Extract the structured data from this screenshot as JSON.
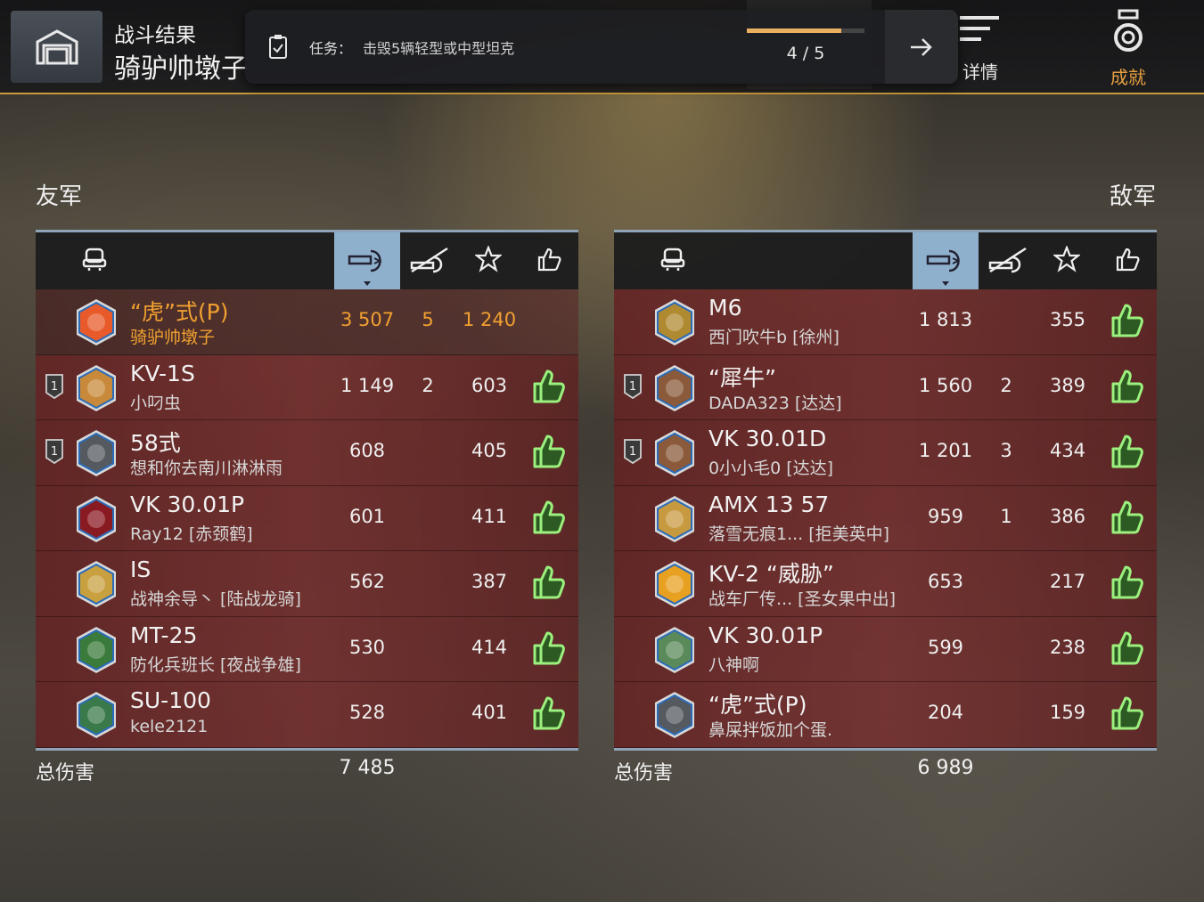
{
  "header": {
    "battle_label": "战斗结果",
    "player_name": "骑驴帅墩子",
    "nav": [
      {
        "label": "详情",
        "icon": "details-icon"
      },
      {
        "label": "成就",
        "icon": "medal-icon"
      }
    ]
  },
  "quest": {
    "label": "任务：",
    "text": "击毁5辆轻型或中型坦克",
    "progress_text": "4 / 5",
    "progress_fraction": 0.8
  },
  "ally": {
    "title": "友军",
    "total_label": "总伤害",
    "total_value": "7 485",
    "rows": [
      {
        "tank": "“虎”式(P)",
        "player": "骑驴帅墩子",
        "damage": "3 507",
        "kills": "5",
        "xp": "1 240",
        "self": true,
        "platoon": false,
        "rank_color": "#e85a2a",
        "liked": false
      },
      {
        "tank": "KV-1S",
        "player": "小叼虫",
        "damage": "1 149",
        "kills": "2",
        "xp": "603",
        "platoon": true,
        "rank_color": "#c88a3a",
        "liked": true
      },
      {
        "tank": "58式",
        "player": "想和你去南川淋淋雨",
        "damage": "608",
        "kills": "",
        "xp": "405",
        "platoon": true,
        "rank_color": "#555a60",
        "liked": true
      },
      {
        "tank": "VK 30.01P",
        "player": "Ray12 [赤颈鹤]",
        "damage": "601",
        "kills": "",
        "xp": "411",
        "platoon": false,
        "rank_color": "#8a1a22",
        "liked": true
      },
      {
        "tank": "IS",
        "player": "战神余导丶 [陆战龙骑]",
        "damage": "562",
        "kills": "",
        "xp": "387",
        "platoon": false,
        "rank_color": "#c8a040",
        "liked": true
      },
      {
        "tank": "MT-25",
        "player": "防化兵班长 [夜战争雄]",
        "damage": "530",
        "kills": "",
        "xp": "414",
        "platoon": false,
        "rank_color": "#3a7a3a",
        "liked": true
      },
      {
        "tank": "SU-100",
        "player": "kele2121",
        "damage": "528",
        "kills": "",
        "xp": "401",
        "platoon": false,
        "rank_color": "#3a7a4a",
        "liked": true
      }
    ]
  },
  "enemy": {
    "title": "敌军",
    "total_label": "总伤害",
    "total_value": "6 989",
    "rows": [
      {
        "tank": "M6",
        "player": "西门吹牛b [徐州]",
        "damage": "1 813",
        "kills": "",
        "xp": "355",
        "platoon": false,
        "rank_color": "#b08a30",
        "liked": true
      },
      {
        "tank": "“犀牛”",
        "player": "DADA323 [达达]",
        "damage": "1 560",
        "kills": "2",
        "xp": "389",
        "platoon": true,
        "rank_color": "#8a5a3a",
        "liked": true
      },
      {
        "tank": "VK 30.01D",
        "player": "0小小毛0 [达达]",
        "damage": "1 201",
        "kills": "3",
        "xp": "434",
        "platoon": true,
        "rank_color": "#8a5a3a",
        "liked": true
      },
      {
        "tank": "AMX 13 57",
        "player": "落雪无痕1...  [拒美英中]",
        "damage": "959",
        "kills": "1",
        "xp": "386",
        "platoon": false,
        "rank_color": "#c89a40",
        "liked": true
      },
      {
        "tank": "KV-2 “威胁”",
        "player": "战车厂传... [圣女果中出]",
        "damage": "653",
        "kills": "",
        "xp": "217",
        "platoon": false,
        "rank_color": "#e8a020",
        "liked": true
      },
      {
        "tank": "VK 30.01P",
        "player": "八神啊",
        "damage": "599",
        "kills": "",
        "xp": "238",
        "platoon": false,
        "rank_color": "#5a8a5a",
        "liked": true
      },
      {
        "tank": "“虎”式(P)",
        "player": "鼻屎拌饭加个蛋.",
        "damage": "204",
        "kills": "",
        "xp": "159",
        "platoon": false,
        "rank_color": "#555a60",
        "liked": true
      }
    ]
  },
  "colors": {
    "accent": "#c89a3c",
    "self_highlight": "#f0a030",
    "like_green": "#8ee07a",
    "header_selected": "#8fb0cc"
  }
}
